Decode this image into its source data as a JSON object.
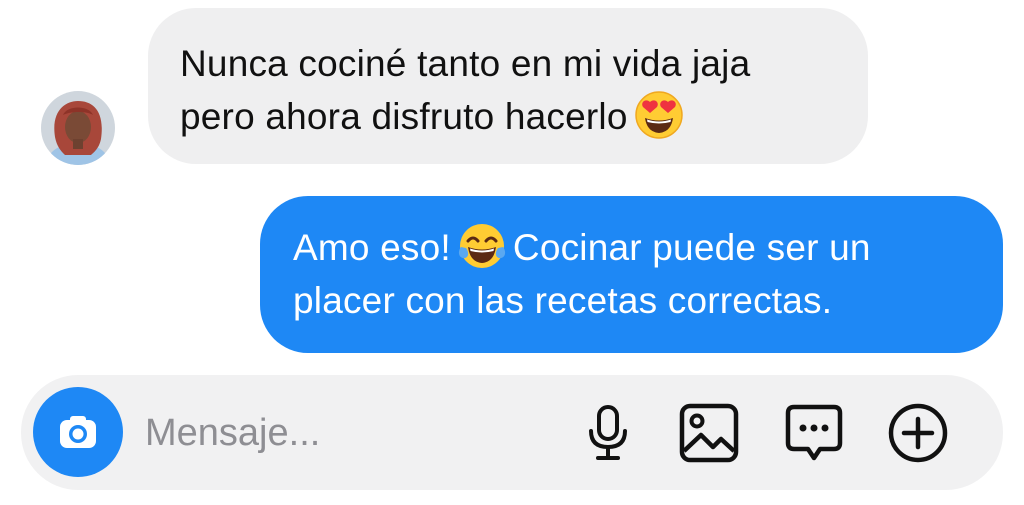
{
  "conversation": {
    "incoming": {
      "lines": [
        "Nunca cociné tanto en mi vida jaja",
        "pero ahora disfruto hacerlo"
      ],
      "emoji": "heart-eyes-emoji"
    },
    "outgoing": {
      "line1_before": "Amo eso!",
      "line1_after": "Cocinar puede ser un",
      "line2": "placer con las recetas correctas.",
      "emoji": "tears-of-joy-emoji"
    }
  },
  "composer": {
    "placeholder": "Mensaje...",
    "value": "",
    "icons": [
      "camera-icon",
      "microphone-icon",
      "image-icon",
      "sticker-chat-icon",
      "plus-circle-icon"
    ]
  },
  "colors": {
    "accent": "#1e88f5",
    "incoming_bubble": "#efeff0",
    "composer_bg": "#f1f1f2",
    "placeholder": "#8e8e93"
  }
}
